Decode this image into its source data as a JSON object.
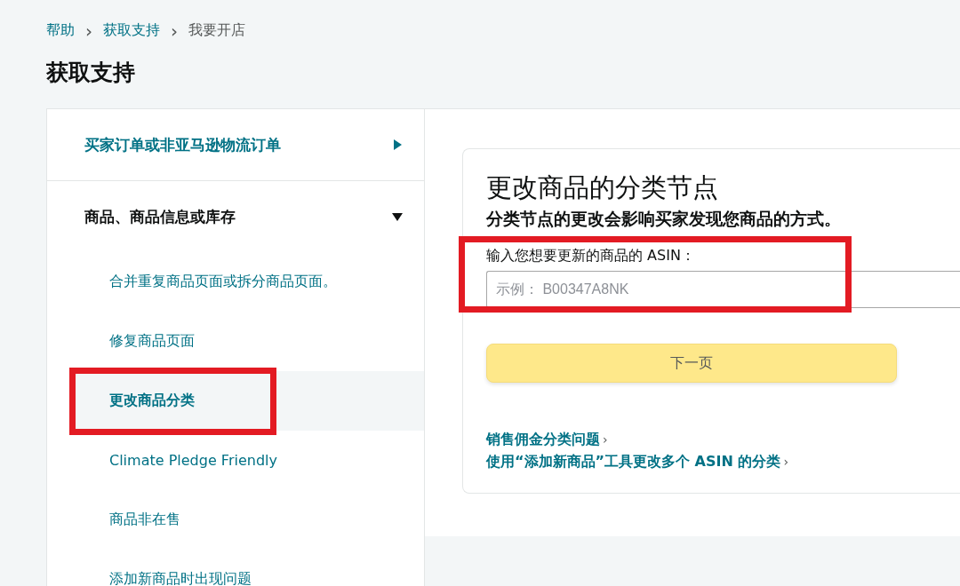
{
  "breadcrumb": [
    {
      "label": "帮助",
      "link": true
    },
    {
      "label": "获取支持",
      "link": true
    },
    {
      "label": "我要开店",
      "link": false
    }
  ],
  "breadcrumb_separator": "›",
  "title": "获取支持",
  "sidebar": {
    "categories": [
      {
        "label": "买家订单或非亚马逊物流订单",
        "expanded": false
      },
      {
        "label": "商品、商品信息或库存",
        "expanded": true,
        "children": [
          {
            "label": "合并重复商品页面或拆分商品页面。",
            "selected": false
          },
          {
            "label": "修复商品页面",
            "selected": false
          },
          {
            "label": "更改商品分类",
            "selected": true
          },
          {
            "label": "Climate Pledge Friendly",
            "selected": false
          },
          {
            "label": "商品非在售",
            "selected": false
          },
          {
            "label": "添加新商品时出现问题",
            "selected": false
          }
        ]
      }
    ]
  },
  "card": {
    "title": "更改商品的分类节点",
    "subtitle": "分类节点的更改会影响买家发现您商品的方式。",
    "field_label": "输入您想要更新的商品的 ASIN：",
    "field": {
      "placeholder": "示例： B00347A8NK"
    },
    "button": "下一页",
    "links": [
      {
        "label": "销售佣金分类问题",
        "chevron": "›"
      },
      {
        "label": "使用“添加新商品”工具更改多个 ASIN 的分类",
        "chevron": "›"
      }
    ]
  }
}
